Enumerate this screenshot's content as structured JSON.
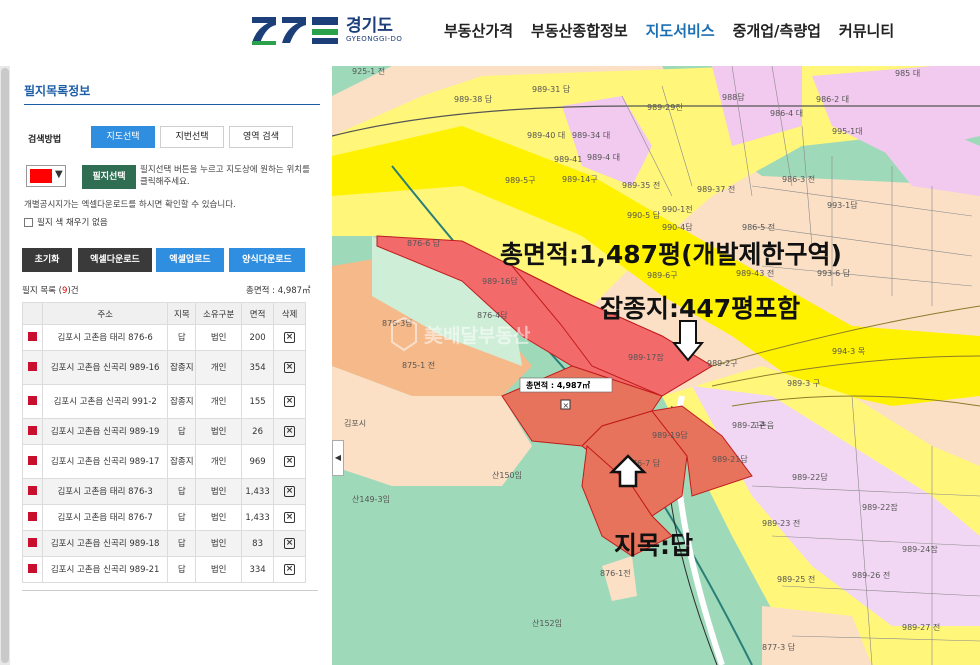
{
  "header": {
    "logo_ko": "경기도",
    "logo_en": "GYEONGGI-DO",
    "nav": [
      {
        "label": "부동산가격",
        "active": false
      },
      {
        "label": "부동산종합정보",
        "active": false
      },
      {
        "label": "지도서비스",
        "active": true
      },
      {
        "label": "중개업/측량업",
        "active": false
      },
      {
        "label": "커뮤니티",
        "active": false
      }
    ]
  },
  "panel": {
    "title": "필지목록정보",
    "method_label": "검색방법",
    "tabs": [
      "지도선택",
      "지번선택",
      "영역 검색"
    ],
    "selected_color": "#ff0000",
    "pick_button": "필지선택",
    "pick_help": "필지선택 버튼을 누르고 지도상에 원하는 위치를 클릭해주세요.",
    "notice": "개별공시지가는 엑셀다운로드를 하시면 확인할 수 있습니다.",
    "fill_option": "필지 색 채우기 없음",
    "buttons": {
      "reset": "초기화",
      "excel_download": "엑셀다운로드",
      "excel_upload": "엑셀업로드",
      "form_download": "양식다운로드"
    },
    "list_prefix": "필지 목록 (",
    "list_count": "9",
    "list_suffix": ")건",
    "total_area": "총면적 : 4,987㎡",
    "columns": [
      "주소",
      "지목",
      "소유구분",
      "면적",
      "삭제"
    ],
    "rows": [
      {
        "address": "김포시 고촌읍 태리 876-6",
        "jimok": "답",
        "owner": "법인",
        "area": "200"
      },
      {
        "address": "김포시 고촌읍 신곡리 989-16",
        "jimok": "잡종지",
        "owner": "개인",
        "area": "354"
      },
      {
        "address": "김포시 고촌읍 신곡리 991-2",
        "jimok": "잡종지",
        "owner": "개인",
        "area": "155"
      },
      {
        "address": "김포시 고촌읍 신곡리 989-19",
        "jimok": "답",
        "owner": "법인",
        "area": "26"
      },
      {
        "address": "김포시 고촌읍 신곡리 989-17",
        "jimok": "잡종지",
        "owner": "개인",
        "area": "969"
      },
      {
        "address": "김포시 고촌읍 태리 876-3",
        "jimok": "답",
        "owner": "법인",
        "area": "1,433"
      },
      {
        "address": "김포시 고촌읍 태리 876-7",
        "jimok": "답",
        "owner": "법인",
        "area": "1,433"
      },
      {
        "address": "김포시 고촌읍 신곡리 989-18",
        "jimok": "답",
        "owner": "법인",
        "area": "83"
      },
      {
        "address": "김포시 고촌읍 신곡리 989-21",
        "jimok": "답",
        "owner": "법인",
        "area": "334"
      }
    ],
    "delete_glyph": "×"
  },
  "map": {
    "annotations": {
      "total_area": "총면적:1,487평(개발제한구역)",
      "mixed_land": "잡종지:447평포함",
      "jimok": "지목:답",
      "map_total": "총면적 : 4,987㎡"
    },
    "watermark": "美배달부동산",
    "parcel_labels": [
      "925-1 전",
      "989-38 답",
      "989-31 답",
      "989-29전",
      "988답",
      "985 대",
      "986-2 대",
      "986-4 대",
      "995-1대",
      "989-34 대",
      "989-40 대",
      "989-41",
      "989-4 대",
      "989-5구",
      "989-14구",
      "989-35 전",
      "989-37 전",
      "986-3 전",
      "990-5 답",
      "990-1전",
      "990-4답",
      "986-5 전",
      "993-1답",
      "876-6 답",
      "989-16답",
      "989-6구",
      "989-43 전",
      "993-6 답",
      "876-4답",
      "876-3답",
      "989-17잡",
      "989-2구",
      "994-3 목",
      "875-1 전",
      "989-3 구",
      "989-2 구",
      "989-19답",
      "989-21답",
      "989-22답",
      "876-7 답",
      "989-22잡",
      "989-23 전",
      "989-24잡",
      "876-1전",
      "989-25 전",
      "989-26 전",
      "989-27 전",
      "877-3 답",
      "산149-3임",
      "산150임",
      "산152임",
      "김포시",
      "고촌읍"
    ]
  }
}
